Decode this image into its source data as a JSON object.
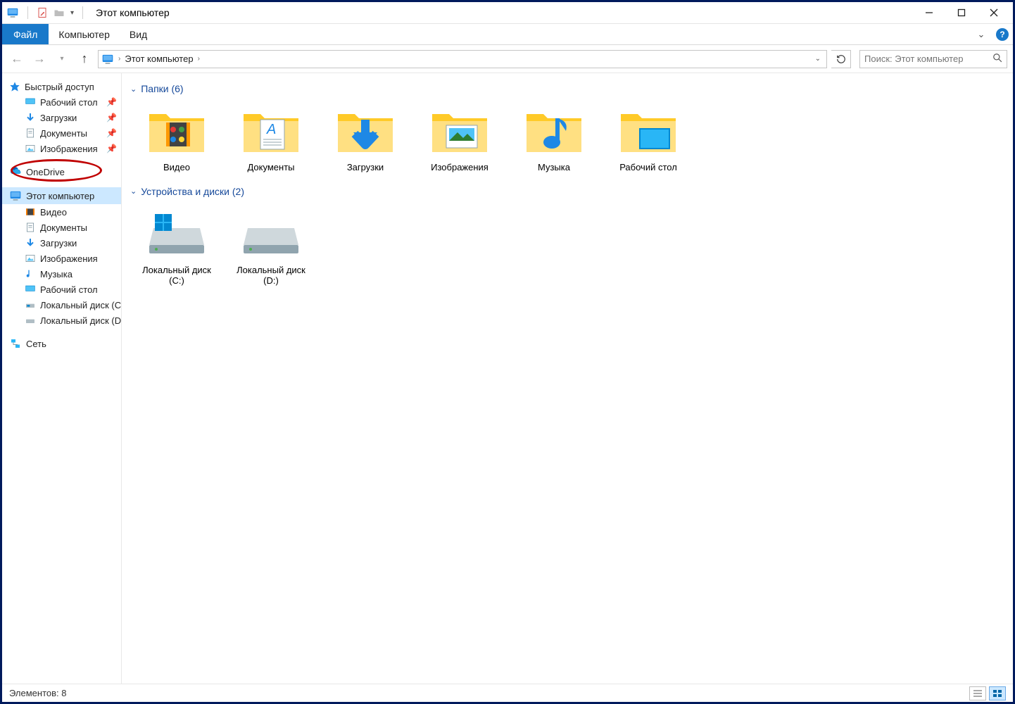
{
  "window": {
    "title": "Этот компьютер"
  },
  "ribbon": {
    "file": "Файл",
    "tabs": [
      "Компьютер",
      "Вид"
    ]
  },
  "nav": {
    "location": "Этот компьютер",
    "search_placeholder": "Поиск: Этот компьютер"
  },
  "sidebar": {
    "quick": "Быстрый доступ",
    "quick_items": [
      {
        "label": "Рабочий стол",
        "pinned": true,
        "icon": "desktop"
      },
      {
        "label": "Загрузки",
        "pinned": true,
        "icon": "downloads"
      },
      {
        "label": "Документы",
        "pinned": true,
        "icon": "documents"
      },
      {
        "label": "Изображения",
        "pinned": true,
        "icon": "pictures"
      }
    ],
    "onedrive": "OneDrive",
    "thispc": "Этот компьютер",
    "thispc_items": [
      {
        "label": "Видео",
        "icon": "videos"
      },
      {
        "label": "Документы",
        "icon": "documents"
      },
      {
        "label": "Загрузки",
        "icon": "downloads"
      },
      {
        "label": "Изображения",
        "icon": "pictures"
      },
      {
        "label": "Музыка",
        "icon": "music"
      },
      {
        "label": "Рабочий стол",
        "icon": "desktop"
      },
      {
        "label": "Локальный диск (C:)",
        "icon": "drive-os"
      },
      {
        "label": "Локальный диск (D:)",
        "icon": "drive"
      }
    ],
    "network": "Сеть"
  },
  "content": {
    "folders_header": "Папки (6)",
    "folders": [
      {
        "label": "Видео",
        "icon": "folder-videos"
      },
      {
        "label": "Документы",
        "icon": "folder-documents"
      },
      {
        "label": "Загрузки",
        "icon": "folder-downloads"
      },
      {
        "label": "Изображения",
        "icon": "folder-pictures"
      },
      {
        "label": "Музыка",
        "icon": "folder-music"
      },
      {
        "label": "Рабочий стол",
        "icon": "folder-desktop"
      }
    ],
    "drives_header": "Устройства и диски (2)",
    "drives": [
      {
        "label": "Локальный диск (C:)",
        "icon": "drive-os"
      },
      {
        "label": "Локальный диск (D:)",
        "icon": "drive"
      }
    ]
  },
  "status": {
    "items": "Элементов: 8"
  }
}
